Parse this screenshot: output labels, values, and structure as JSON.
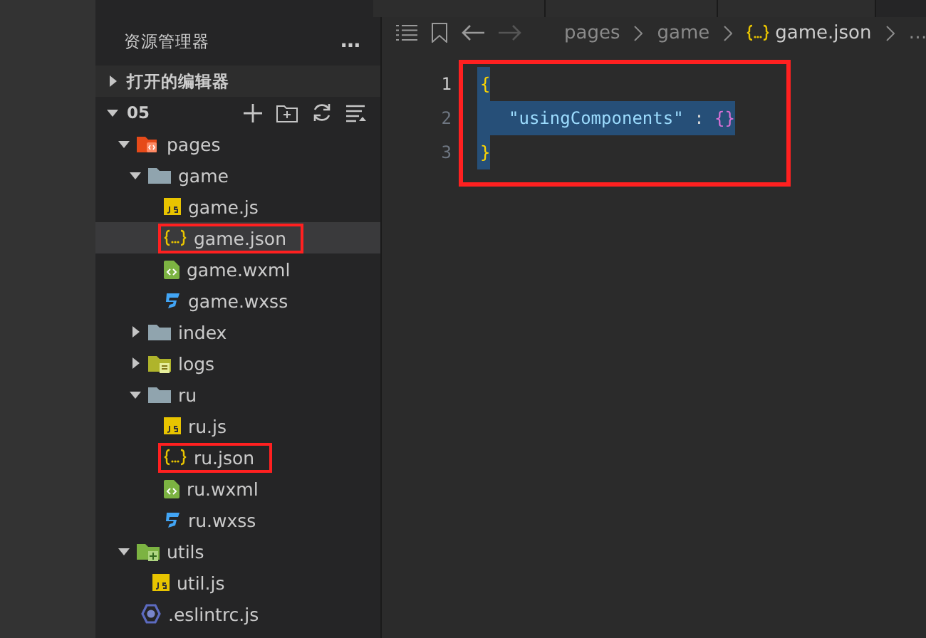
{
  "explorer": {
    "title": "资源管理器",
    "more": "…",
    "sections": [
      {
        "label": "打开的编辑器",
        "expanded": false
      },
      {
        "label": "05",
        "expanded": true
      }
    ]
  },
  "tree": [
    {
      "name": "pages",
      "kind": "pages",
      "expanded": true,
      "children": [
        {
          "name": "game",
          "kind": "folder",
          "expanded": true,
          "children": [
            {
              "name": "game.js",
              "kind": "js",
              "selected": false,
              "boxed": false
            },
            {
              "name": "game.json",
              "kind": "json",
              "selected": true,
              "boxed": true
            },
            {
              "name": "game.wxml",
              "kind": "wxml",
              "selected": false,
              "boxed": false
            },
            {
              "name": "game.wxss",
              "kind": "wxss",
              "selected": false,
              "boxed": false
            }
          ]
        },
        {
          "name": "index",
          "kind": "folder",
          "expanded": false
        },
        {
          "name": "logs",
          "kind": "logs",
          "expanded": false
        },
        {
          "name": "ru",
          "kind": "folder",
          "expanded": true,
          "children": [
            {
              "name": "ru.js",
              "kind": "js",
              "selected": false,
              "boxed": false
            },
            {
              "name": "ru.json",
              "kind": "json",
              "selected": false,
              "boxed": true
            },
            {
              "name": "ru.wxml",
              "kind": "wxml",
              "selected": false,
              "boxed": false
            },
            {
              "name": "ru.wxss",
              "kind": "wxss",
              "selected": false,
              "boxed": false
            }
          ]
        }
      ]
    },
    {
      "name": "utils",
      "kind": "utils",
      "expanded": true,
      "children": [
        {
          "name": "util.js",
          "kind": "js",
          "selected": false,
          "boxed": false
        }
      ]
    },
    {
      "name": ".eslintrc.js",
      "kind": "eslint",
      "selected": false,
      "boxed": false
    }
  ],
  "breadcrumb": [
    "pages",
    "game",
    "game.json",
    "…"
  ],
  "editor": {
    "boxed": true,
    "lines": [
      {
        "number": "1",
        "selected": true,
        "tokens": [
          {
            "text": "{",
            "kind": "brace"
          }
        ]
      },
      {
        "number": "2",
        "selected": true,
        "tokens": [
          {
            "text": "\"usingComponents\"",
            "kind": "key"
          },
          {
            "text": ":",
            "kind": "punct"
          },
          {
            "text": "{}",
            "kind": "brace2"
          }
        ]
      },
      {
        "number": "3",
        "selected": true,
        "tokens": [
          {
            "text": "}",
            "kind": "brace"
          }
        ]
      }
    ]
  }
}
